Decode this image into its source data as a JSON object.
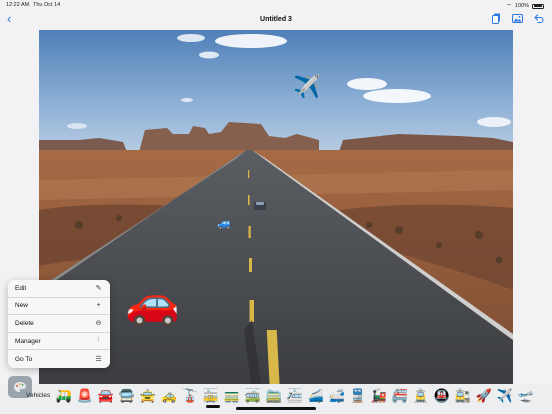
{
  "status": {
    "time": "12:22 AM",
    "date": "Thu Oct 14",
    "battery": "100%"
  },
  "nav": {
    "back_icon": "chevron-left-icon",
    "title": "Untitled 3",
    "actions": [
      "document-icon",
      "photo-icon",
      "undo-icon"
    ],
    "accent": "#2a7ae2"
  },
  "canvas": {
    "background": "desert road photo",
    "stickers": [
      {
        "name": "airplane",
        "glyph": "✈️"
      },
      {
        "name": "red-car",
        "glyph": "🚗"
      },
      {
        "name": "small-car",
        "glyph": "🚙"
      }
    ]
  },
  "menu": {
    "items": [
      {
        "label": "Edit",
        "icon": "pencil-icon",
        "glyph": "✎"
      },
      {
        "label": "New",
        "icon": "plus-icon",
        "glyph": "+"
      },
      {
        "label": "Delete",
        "icon": "minus-circle-icon",
        "glyph": "⊖"
      },
      {
        "label": "Manager",
        "icon": "sliders-icon",
        "glyph": "⫶"
      },
      {
        "label": "Go To",
        "icon": "list-icon",
        "glyph": "☰"
      }
    ]
  },
  "palette": {
    "icon": "palette-icon"
  },
  "emoji_bar": {
    "category": "Vehicles",
    "items": [
      "🛺",
      "🚨",
      "🚘",
      "🚍",
      "🚖",
      "🚕",
      "🚡",
      "🚋",
      "🚃",
      "🚎",
      "🚞",
      "🚈",
      "🚄",
      "🚅",
      "🚆",
      "🚂",
      "🚝",
      "🚊",
      "🚇",
      "🚉",
      "🚀",
      "✈️",
      "🛫"
    ]
  }
}
